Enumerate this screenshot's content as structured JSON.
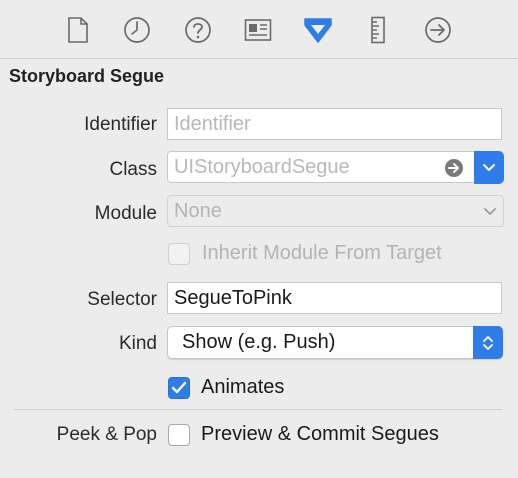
{
  "toolbar": {
    "tabs": [
      {
        "icon": "file-icon",
        "selected": false
      },
      {
        "icon": "clock-icon",
        "selected": false
      },
      {
        "icon": "help-icon",
        "selected": false
      },
      {
        "icon": "identity-card-icon",
        "selected": false
      },
      {
        "icon": "attributes-inspector-icon",
        "selected": true
      },
      {
        "icon": "ruler-icon",
        "selected": false
      },
      {
        "icon": "connections-arrow-icon",
        "selected": false
      }
    ],
    "accent_color": "#2f7de8"
  },
  "section": {
    "title": "Storyboard Segue"
  },
  "identifier": {
    "label": "Identifier",
    "placeholder": "Identifier",
    "value": ""
  },
  "class": {
    "label": "Class",
    "placeholder": "UIStoryboardSegue"
  },
  "module": {
    "label": "Module",
    "value": "None"
  },
  "inherit_module": {
    "label": "Inherit Module From Target",
    "checked": false,
    "enabled": false
  },
  "selector": {
    "label": "Selector",
    "value": "SegueToPink"
  },
  "kind": {
    "label": "Kind",
    "value": "Show (e.g. Push)"
  },
  "animates": {
    "label": "Animates",
    "checked": true
  },
  "peek_pop": {
    "label": "Peek & Pop",
    "checkbox_label": "Preview & Commit Segues",
    "checked": false
  }
}
